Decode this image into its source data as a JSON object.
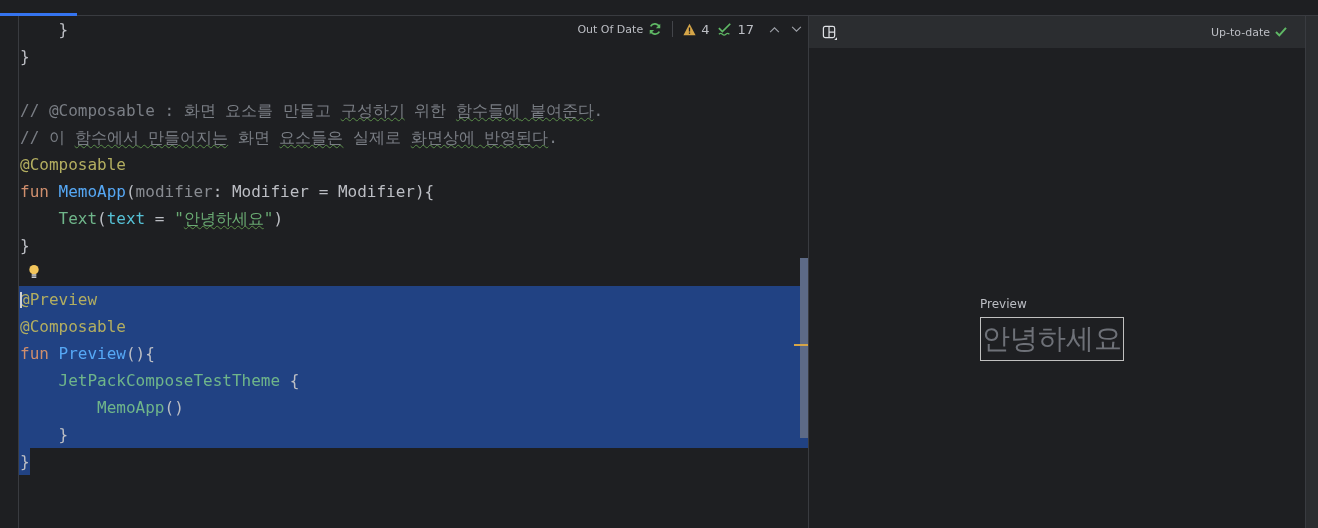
{
  "editor_toolbar": {
    "status": "Out Of Date",
    "warnings": "4",
    "checks": "17"
  },
  "code_lines": [
    {
      "selected": false,
      "tokens": [
        {
          "t": "    }",
          "kind": "plain"
        }
      ]
    },
    {
      "selected": false,
      "tokens": [
        {
          "t": "}",
          "kind": "plain"
        }
      ]
    },
    {
      "selected": false
    },
    {
      "selected": false,
      "tokens": [
        {
          "t": "// @Composable : 화면 요소를 만들고 ",
          "kind": "comment"
        },
        {
          "t": "구성하기",
          "kind": "comment-typo"
        },
        {
          "t": " 위한 ",
          "kind": "comment"
        },
        {
          "t": "함수들에",
          "kind": "comment-typo"
        },
        {
          "t": " 붙여준다",
          "kind": "comment-typo"
        },
        {
          "t": ".",
          "kind": "comment"
        }
      ]
    },
    {
      "selected": false,
      "tokens": [
        {
          "t": "// 이 ",
          "kind": "comment"
        },
        {
          "t": "함수에서",
          "kind": "comment-typo"
        },
        {
          "t": " 만들어지는",
          "kind": "comment-typo"
        },
        {
          "t": " 화면 ",
          "kind": "comment"
        },
        {
          "t": "요소들은",
          "kind": "comment-typo"
        },
        {
          "t": " 실제로 ",
          "kind": "comment"
        },
        {
          "t": "화면상에",
          "kind": "comment-typo"
        },
        {
          "t": " 반영된다",
          "kind": "comment-typo"
        },
        {
          "t": ".",
          "kind": "comment"
        }
      ]
    },
    {
      "selected": false,
      "tokens": [
        {
          "t": "@Composable",
          "kind": "annotation"
        }
      ]
    },
    {
      "selected": false,
      "tokens": [
        {
          "t": "fun ",
          "kind": "keyword"
        },
        {
          "t": "MemoApp",
          "kind": "function"
        },
        {
          "t": "(",
          "kind": "plain"
        },
        {
          "t": "modifier",
          "kind": "param"
        },
        {
          "t": ": Modifier = Modifier){",
          "kind": "plain"
        }
      ]
    },
    {
      "selected": false,
      "tokens": [
        {
          "t": "    Text",
          "kind": "call"
        },
        {
          "t": "(",
          "kind": "plain"
        },
        {
          "t": "text",
          "kind": "named-arg"
        },
        {
          "t": " = ",
          "kind": "plain"
        },
        {
          "t": "\"",
          "kind": "string"
        },
        {
          "t": "안녕하세요",
          "kind": "string-typo"
        },
        {
          "t": "\"",
          "kind": "string"
        },
        {
          "t": ")",
          "kind": "plain"
        }
      ]
    },
    {
      "selected": false,
      "tokens": [
        {
          "t": "}",
          "kind": "plain"
        }
      ]
    },
    {
      "selected": false,
      "bulb": true
    },
    {
      "selected": true,
      "caret": true,
      "tokens": [
        {
          "t": "@Preview",
          "kind": "annotation"
        }
      ]
    },
    {
      "selected": true,
      "tokens": [
        {
          "t": "@Composable",
          "kind": "annotation"
        }
      ]
    },
    {
      "selected": true,
      "tokens": [
        {
          "t": "fun ",
          "kind": "keyword"
        },
        {
          "t": "Preview",
          "kind": "function"
        },
        {
          "t": "(){",
          "kind": "plain"
        }
      ]
    },
    {
      "selected": true,
      "tokens": [
        {
          "t": "    JetPackComposeTestTheme",
          "kind": "call"
        },
        {
          "t": " {",
          "kind": "plain"
        }
      ]
    },
    {
      "selected": true,
      "tokens": [
        {
          "t": "        MemoApp",
          "kind": "call"
        },
        {
          "t": "()",
          "kind": "plain"
        }
      ]
    },
    {
      "selected": true,
      "tokens": [
        {
          "t": "    }",
          "kind": "plain"
        }
      ]
    },
    {
      "selected": true,
      "tokens": [
        {
          "t": "}",
          "kind": "plain"
        }
      ]
    }
  ],
  "preview_panel": {
    "status": "Up-to-date",
    "preview_label": "Preview",
    "preview_text": "안녕하세요"
  }
}
